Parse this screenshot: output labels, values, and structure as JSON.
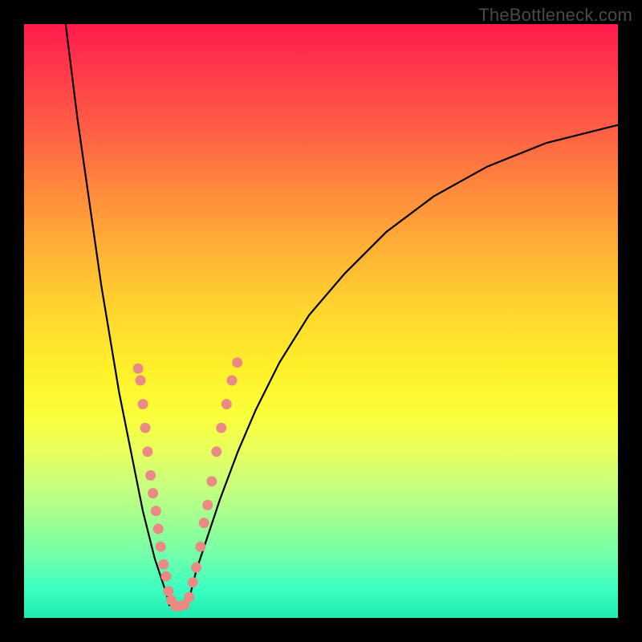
{
  "watermark": "TheBottleneck.com",
  "colors": {
    "page_bg": "#000000",
    "curve": "#000000",
    "dots": "#e98b84",
    "gradient_top": "#ff1a4d",
    "gradient_bottom": "#20e9b0"
  },
  "chart_data": {
    "type": "line",
    "title": "",
    "xlabel": "",
    "ylabel": "",
    "xlim": [
      0,
      100
    ],
    "ylim": [
      0,
      100
    ],
    "grid": false,
    "legend": false,
    "series": [
      {
        "name": "bottleneck-curve-left",
        "x": [
          7,
          8,
          9,
          10,
          11,
          12,
          13,
          14,
          15,
          16,
          17,
          18,
          19,
          20,
          21,
          22,
          23,
          24,
          24.5
        ],
        "y": [
          100,
          92,
          84,
          77,
          70,
          63,
          56,
          50,
          44,
          38,
          33,
          28,
          23,
          18,
          14,
          10,
          7,
          4,
          2
        ]
      },
      {
        "name": "bottleneck-curve-right",
        "x": [
          27.5,
          28,
          29,
          31,
          33,
          36,
          39,
          43,
          48,
          54,
          61,
          69,
          78,
          88,
          100
        ],
        "y": [
          2,
          4,
          8,
          14,
          20,
          28,
          35,
          43,
          51,
          58,
          65,
          71,
          76,
          80,
          83
        ]
      }
    ],
    "dots": [
      {
        "x": 19.2,
        "y": 42
      },
      {
        "x": 19.6,
        "y": 40
      },
      {
        "x": 20.0,
        "y": 36
      },
      {
        "x": 20.4,
        "y": 32
      },
      {
        "x": 20.8,
        "y": 28
      },
      {
        "x": 21.3,
        "y": 24
      },
      {
        "x": 21.7,
        "y": 21
      },
      {
        "x": 22.2,
        "y": 18
      },
      {
        "x": 22.6,
        "y": 15
      },
      {
        "x": 23.0,
        "y": 12
      },
      {
        "x": 23.5,
        "y": 9
      },
      {
        "x": 23.9,
        "y": 7
      },
      {
        "x": 24.3,
        "y": 4.5
      },
      {
        "x": 24.8,
        "y": 3
      },
      {
        "x": 25.5,
        "y": 2
      },
      {
        "x": 26.2,
        "y": 2
      },
      {
        "x": 27.0,
        "y": 2.2
      },
      {
        "x": 27.8,
        "y": 3.5
      },
      {
        "x": 28.4,
        "y": 6
      },
      {
        "x": 29.0,
        "y": 8.5
      },
      {
        "x": 29.7,
        "y": 12
      },
      {
        "x": 30.3,
        "y": 16
      },
      {
        "x": 30.9,
        "y": 19
      },
      {
        "x": 31.6,
        "y": 23
      },
      {
        "x": 32.4,
        "y": 28
      },
      {
        "x": 33.2,
        "y": 32
      },
      {
        "x": 34.1,
        "y": 36
      },
      {
        "x": 35.0,
        "y": 40
      },
      {
        "x": 35.9,
        "y": 43
      }
    ]
  }
}
